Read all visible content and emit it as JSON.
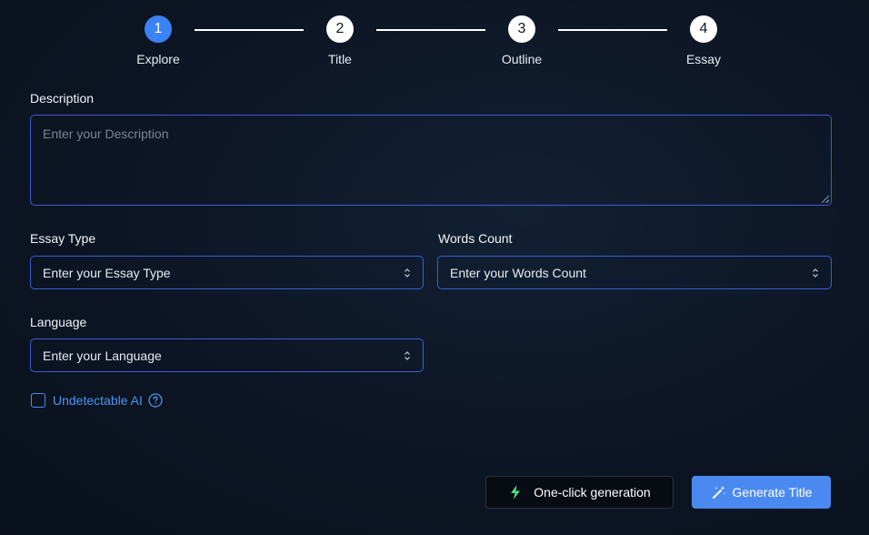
{
  "stepper": {
    "steps": [
      {
        "number": "1",
        "label": "Explore"
      },
      {
        "number": "2",
        "label": "Title"
      },
      {
        "number": "3",
        "label": "Outline"
      },
      {
        "number": "4",
        "label": "Essay"
      }
    ],
    "active_step": 1
  },
  "form": {
    "description": {
      "label": "Description",
      "placeholder": "Enter your Description"
    },
    "essay_type": {
      "label": "Essay Type",
      "value": "Enter your Essay Type"
    },
    "words_count": {
      "label": "Words Count",
      "value": "Enter your Words Count"
    },
    "language": {
      "label": "Language",
      "value": "Enter your Language"
    },
    "undetectable": {
      "label": "Undetectable AI",
      "checked": false
    }
  },
  "actions": {
    "one_click_label": "One-click generation",
    "generate_label": "Generate Title"
  },
  "colors": {
    "accent": "#3b82f6",
    "border": "#3d5bd6",
    "bolt": "#4ade80",
    "link": "#4a96f2"
  },
  "icons": {
    "help": "help-circle-icon",
    "bolt": "lightning-bolt-icon",
    "wand": "magic-wand-icon",
    "select": "chevron-up-down-icon"
  }
}
